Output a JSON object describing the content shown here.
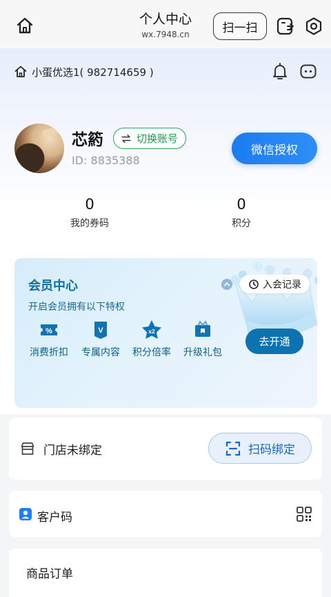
{
  "header": {
    "title": "个人中心",
    "subtitle": "wx.7948.cn",
    "scan_label": "扫一扫"
  },
  "store": {
    "name": "小蛋优选1( 982714659 )"
  },
  "profile": {
    "username": "芯箹",
    "switch_label": "切换账号",
    "user_id": "ID: 8835388",
    "wechat_auth_label": "微信授权"
  },
  "stats": [
    {
      "value": "0",
      "label": "我的券码"
    },
    {
      "value": "0",
      "label": "积分"
    }
  ],
  "member": {
    "title": "会员中心",
    "subtitle": "开启会员拥有以下特权",
    "record_label": "入会记录",
    "join_label": "去开通",
    "perks": [
      {
        "label": "消费折扣",
        "icon": "discount-icon"
      },
      {
        "label": "专属内容",
        "icon": "vip-badge-icon"
      },
      {
        "label": "积分倍率",
        "icon": "star-x2-icon"
      },
      {
        "label": "升级礼包",
        "icon": "gift-icon"
      }
    ],
    "colors": {
      "accent": "#0c72b0",
      "title": "#0f6e9b"
    }
  },
  "binding": {
    "status_label": "门店未绑定",
    "scan_bind_label": "扫码绑定"
  },
  "customer_code": {
    "label": "客户码"
  },
  "orders": {
    "title": "商品订单"
  },
  "colors": {
    "primary_blue": "#1a7cf0",
    "switch_green": "#1f9a52"
  }
}
